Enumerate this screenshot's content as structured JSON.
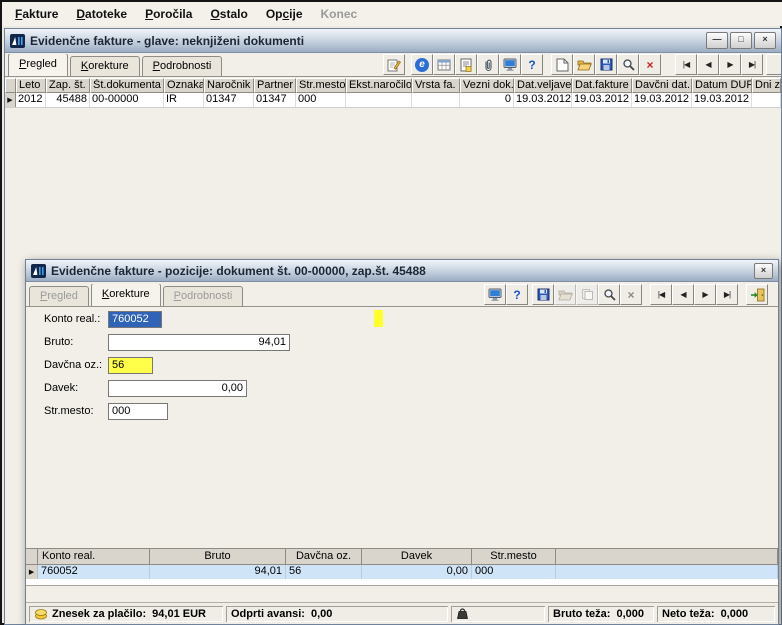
{
  "icons": {
    "help": "?",
    "delete": "×",
    "close": "×",
    "minimize": "—",
    "maximize": "□",
    "globe_e": "e",
    "row_marker": "▶",
    "nav_first": "|◀",
    "nav_prev": "◀",
    "nav_next": "▶",
    "nav_last": "▶|"
  },
  "menu": {
    "items": [
      {
        "label": "Fakture",
        "accel": 0,
        "disabled": false
      },
      {
        "label": "Datoteke",
        "accel": 0,
        "disabled": false
      },
      {
        "label": "Poročila",
        "accel": 0,
        "disabled": false
      },
      {
        "label": "Ostalo",
        "accel": 0,
        "disabled": false
      },
      {
        "label": "Opcije",
        "accel": 2,
        "disabled": false
      },
      {
        "label": "Konec",
        "accel": -1,
        "disabled": true
      }
    ]
  },
  "main_window": {
    "title": "Evidenčne fakture - glave: neknjiženi dokumenti",
    "tabs": [
      {
        "label": "Pregled",
        "accel": 0,
        "active": true
      },
      {
        "label": "Korekture",
        "accel": 0,
        "active": false
      },
      {
        "label": "Podrobnosti",
        "accel": 0,
        "active": false
      }
    ],
    "table": {
      "columns": [
        "Leto",
        "Zap. št.",
        "Št.dokumenta",
        "Oznaka",
        "Naročnik",
        "Partner",
        "Str.mesto",
        "Ekst.naročilo",
        "Vrsta fa.",
        "Vezni dok.",
        "Dat.veljave",
        "Dat.fakture",
        "Davčni dat.",
        "Datum DUR",
        "Dni za"
      ],
      "row": {
        "leto": "2012",
        "zap_st": "45488",
        "st_dokumenta": "00-00000",
        "oznaka": "IR",
        "narocnik": "01347",
        "partner": "01347",
        "str_mesto": "000",
        "ekst_narocilo": "",
        "vrsta_fa": "",
        "vezni_dok": "0",
        "dat_veljave": "19.03.2012",
        "dat_fakture": "19.03.2012",
        "davcni_dat": "19.03.2012",
        "datum_dur": "19.03.2012",
        "dni_za": ""
      }
    }
  },
  "child_window": {
    "title": "Evidenčne fakture - pozicije: dokument št. 00-00000, zap.št. 45488",
    "tabs": [
      {
        "label": "Pregled",
        "accel": 0,
        "disabled": true
      },
      {
        "label": "Korekture",
        "accel": 0,
        "active": true
      },
      {
        "label": "Podrobnosti",
        "accel": 0,
        "disabled": true
      }
    ],
    "form": {
      "konto_label": "Konto real.:",
      "konto_value": "760052",
      "bruto_label": "Bruto:",
      "bruto_value": "94,01",
      "davcna_label": "Davčna oz.:",
      "davcna_value": "56",
      "davek_label": "Davek:",
      "davek_value": "0,00",
      "str_mesto_label": "Str.mesto:",
      "str_mesto_value": "000"
    },
    "grid": {
      "columns": [
        "Konto real.",
        "Bruto",
        "Davčna oz.",
        "Davek",
        "Str.mesto"
      ],
      "row": {
        "konto": "760052",
        "bruto": "94,01",
        "davcna": "56",
        "davek": "0,00",
        "str_mesto": "000"
      }
    },
    "status_bar": {
      "znesek_label": "Znesek za plačilo:",
      "znesek_value": "94,01 EUR",
      "avansi_label": "Odprti avansi:",
      "avansi_value": "0,00",
      "bruto_teza_label": "Bruto teža:",
      "bruto_teza_value": "0,000",
      "neto_teza_label": "Neto teža:",
      "neto_teza_value": "0,000"
    }
  },
  "colors": {
    "selection_blue": "#2e63b8",
    "highlight_yellow": "#ffff4a",
    "row_selected_blue": "#cfe4f7",
    "titlebar_top": "#f2f5f9",
    "titlebar_bottom": "#9cadc2"
  }
}
